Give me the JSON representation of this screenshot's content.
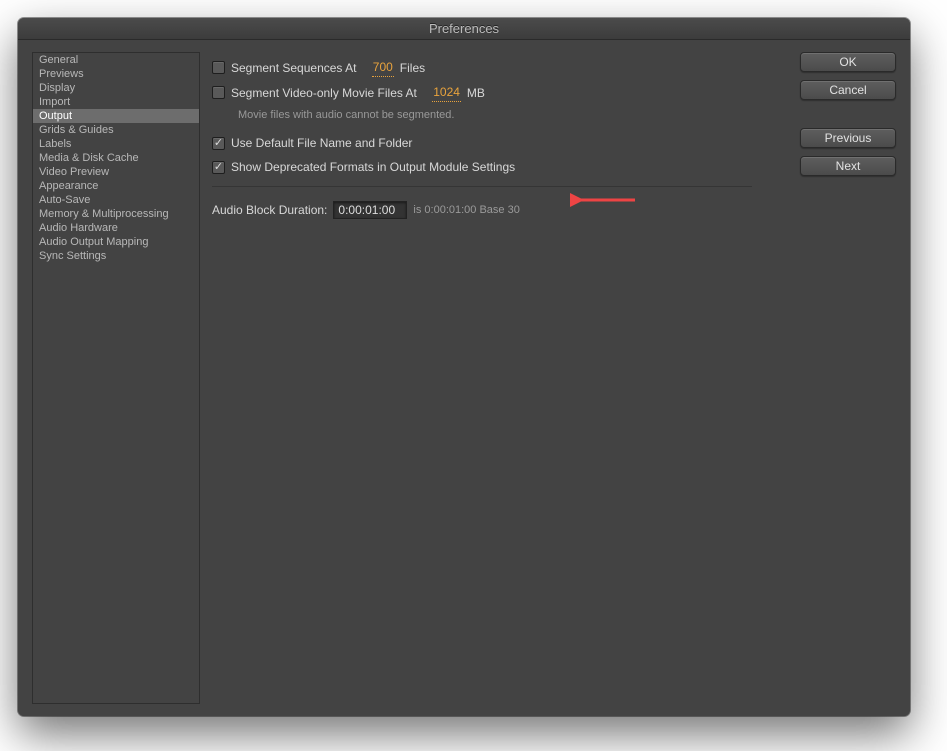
{
  "title": "Preferences",
  "sidebar": {
    "items": [
      {
        "label": "General"
      },
      {
        "label": "Previews"
      },
      {
        "label": "Display"
      },
      {
        "label": "Import"
      },
      {
        "label": "Output",
        "selected": true
      },
      {
        "label": "Grids & Guides"
      },
      {
        "label": "Labels"
      },
      {
        "label": "Media & Disk Cache"
      },
      {
        "label": "Video Preview"
      },
      {
        "label": "Appearance"
      },
      {
        "label": "Auto-Save"
      },
      {
        "label": "Memory & Multiprocessing"
      },
      {
        "label": "Audio Hardware"
      },
      {
        "label": "Audio Output Mapping"
      },
      {
        "label": "Sync Settings"
      }
    ]
  },
  "main": {
    "segSeq": {
      "label_pre": "Segment Sequences At",
      "value": "700",
      "label_post": "Files",
      "checked": false
    },
    "segVid": {
      "label_pre": "Segment Video-only Movie Files At",
      "value": "1024",
      "label_post": "MB",
      "checked": false
    },
    "segVidNote": "Movie files with audio cannot be segmented.",
    "useDefault": {
      "label": "Use Default File Name and Folder",
      "checked": true
    },
    "showDeprecated": {
      "label": "Show Deprecated Formats in Output Module Settings",
      "checked": true
    },
    "audio": {
      "label": "Audio Block Duration:",
      "value": "0:00:01:00",
      "note": "is 0:00:01:00  Base 30"
    }
  },
  "buttons": {
    "ok": "OK",
    "cancel": "Cancel",
    "previous": "Previous",
    "next": "Next"
  }
}
